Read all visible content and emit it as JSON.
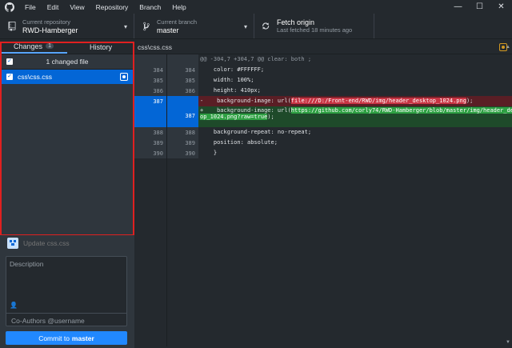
{
  "menu": [
    "File",
    "Edit",
    "View",
    "Repository",
    "Branch",
    "Help"
  ],
  "window": {
    "minimize": "—",
    "maximize": "☐",
    "close": "✕"
  },
  "toolbar": {
    "repo_label": "Current repository",
    "repo_value": "RWD-Hamberger",
    "branch_label": "Current branch",
    "branch_value": "master",
    "fetch_title": "Fetch origin",
    "fetch_sub": "Last fetched 18 minutes ago"
  },
  "sidebar": {
    "tab_changes": "Changes",
    "tab_changes_badge": "1",
    "tab_history": "History",
    "changed_files_label": "1 changed file",
    "files": [
      {
        "name": "css\\css.css"
      }
    ]
  },
  "commit": {
    "summary_placeholder": "Update css.css",
    "description_placeholder": "Description",
    "coauthors_placeholder": "Co-Authors @username",
    "button_prefix": "Commit to",
    "button_branch": "master"
  },
  "diff": {
    "file_path": "css\\css.css",
    "hunk_header": "@@ -304,7 +304,7 @@ clear: both ;",
    "lines": [
      {
        "old": "384",
        "new": "384",
        "text": "    color: #FFFFFF;"
      },
      {
        "old": "385",
        "new": "385",
        "text": "    width: 100%;"
      },
      {
        "old": "386",
        "new": "386",
        "text": "    height: 410px;"
      }
    ],
    "del_line": {
      "old": "387",
      "new": "",
      "prefix": "-    background-image: url(",
      "hl": "file:///D:/Front-end/RWD/img/header_desktop_1024.png",
      "suffix": ");"
    },
    "add_line": {
      "old": "",
      "new": "387",
      "prefix": "+    background-image: url(",
      "hl": "https://github.com/corly74/RWD-Hamberger/blob/master/img/header_deskt",
      "hl2": "op_1024.png?raw=true",
      "suffix": ");"
    },
    "tail_lines": [
      {
        "old": "388",
        "new": "388",
        "text": "    background-repeat: no-repeat;"
      },
      {
        "old": "389",
        "new": "389",
        "text": "    position: absolute;"
      },
      {
        "old": "390",
        "new": "390",
        "text": "    }"
      }
    ]
  }
}
